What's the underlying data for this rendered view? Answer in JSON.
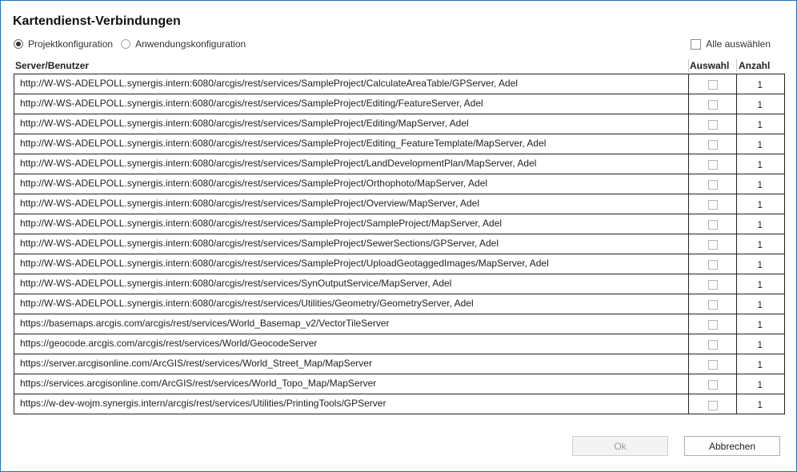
{
  "dialog": {
    "title": "Kartendienst-Verbindungen",
    "options": {
      "project_config": "Projektkonfiguration",
      "app_config": "Anwendungskonfiguration",
      "selected": "project_config"
    },
    "select_all_label": "Alle auswählen",
    "select_all_checked": false
  },
  "table": {
    "columns": {
      "server": "Server/Benutzer",
      "auswahl": "Auswahl",
      "anzahl": "Anzahl"
    },
    "rows": [
      {
        "server": "http://W-WS-ADELPOLL.synergis.intern:6080/arcgis/rest/services/SampleProject/CalculateAreaTable/GPServer, Adel",
        "checked": false,
        "count": "1"
      },
      {
        "server": "http://W-WS-ADELPOLL.synergis.intern:6080/arcgis/rest/services/SampleProject/Editing/FeatureServer, Adel",
        "checked": false,
        "count": "1"
      },
      {
        "server": "http://W-WS-ADELPOLL.synergis.intern:6080/arcgis/rest/services/SampleProject/Editing/MapServer, Adel",
        "checked": false,
        "count": "1"
      },
      {
        "server": "http://W-WS-ADELPOLL.synergis.intern:6080/arcgis/rest/services/SampleProject/Editing_FeatureTemplate/MapServer, Adel",
        "checked": false,
        "count": "1"
      },
      {
        "server": "http://W-WS-ADELPOLL.synergis.intern:6080/arcgis/rest/services/SampleProject/LandDevelopmentPlan/MapServer, Adel",
        "checked": false,
        "count": "1"
      },
      {
        "server": "http://W-WS-ADELPOLL.synergis.intern:6080/arcgis/rest/services/SampleProject/Orthophoto/MapServer, Adel",
        "checked": false,
        "count": "1"
      },
      {
        "server": "http://W-WS-ADELPOLL.synergis.intern:6080/arcgis/rest/services/SampleProject/Overview/MapServer, Adel",
        "checked": false,
        "count": "1"
      },
      {
        "server": "http://W-WS-ADELPOLL.synergis.intern:6080/arcgis/rest/services/SampleProject/SampleProject/MapServer, Adel",
        "checked": false,
        "count": "1"
      },
      {
        "server": "http://W-WS-ADELPOLL.synergis.intern:6080/arcgis/rest/services/SampleProject/SewerSections/GPServer, Adel",
        "checked": false,
        "count": "1"
      },
      {
        "server": "http://W-WS-ADELPOLL.synergis.intern:6080/arcgis/rest/services/SampleProject/UploadGeotaggedImages/MapServer, Adel",
        "checked": false,
        "count": "1"
      },
      {
        "server": "http://W-WS-ADELPOLL.synergis.intern:6080/arcgis/rest/services/SynOutputService/MapServer, Adel",
        "checked": false,
        "count": "1"
      },
      {
        "server": "http://W-WS-ADELPOLL.synergis.intern:6080/arcgis/rest/services/Utilities/Geometry/GeometryServer, Adel",
        "checked": false,
        "count": "1"
      },
      {
        "server": "https://basemaps.arcgis.com/arcgis/rest/services/World_Basemap_v2/VectorTileServer",
        "checked": false,
        "count": "1"
      },
      {
        "server": "https://geocode.arcgis.com/arcgis/rest/services/World/GeocodeServer",
        "checked": false,
        "count": "1"
      },
      {
        "server": "https://server.arcgisonline.com/ArcGIS/rest/services/World_Street_Map/MapServer",
        "checked": false,
        "count": "1"
      },
      {
        "server": "https://services.arcgisonline.com/ArcGIS/rest/services/World_Topo_Map/MapServer",
        "checked": false,
        "count": "1"
      },
      {
        "server": "https://w-dev-wojm.synergis.intern/arcgis/rest/services/Utilities/PrintingTools/GPServer",
        "checked": false,
        "count": "1"
      }
    ]
  },
  "buttons": {
    "ok_label": "Ok",
    "ok_enabled": false,
    "cancel_label": "Abbrechen"
  }
}
